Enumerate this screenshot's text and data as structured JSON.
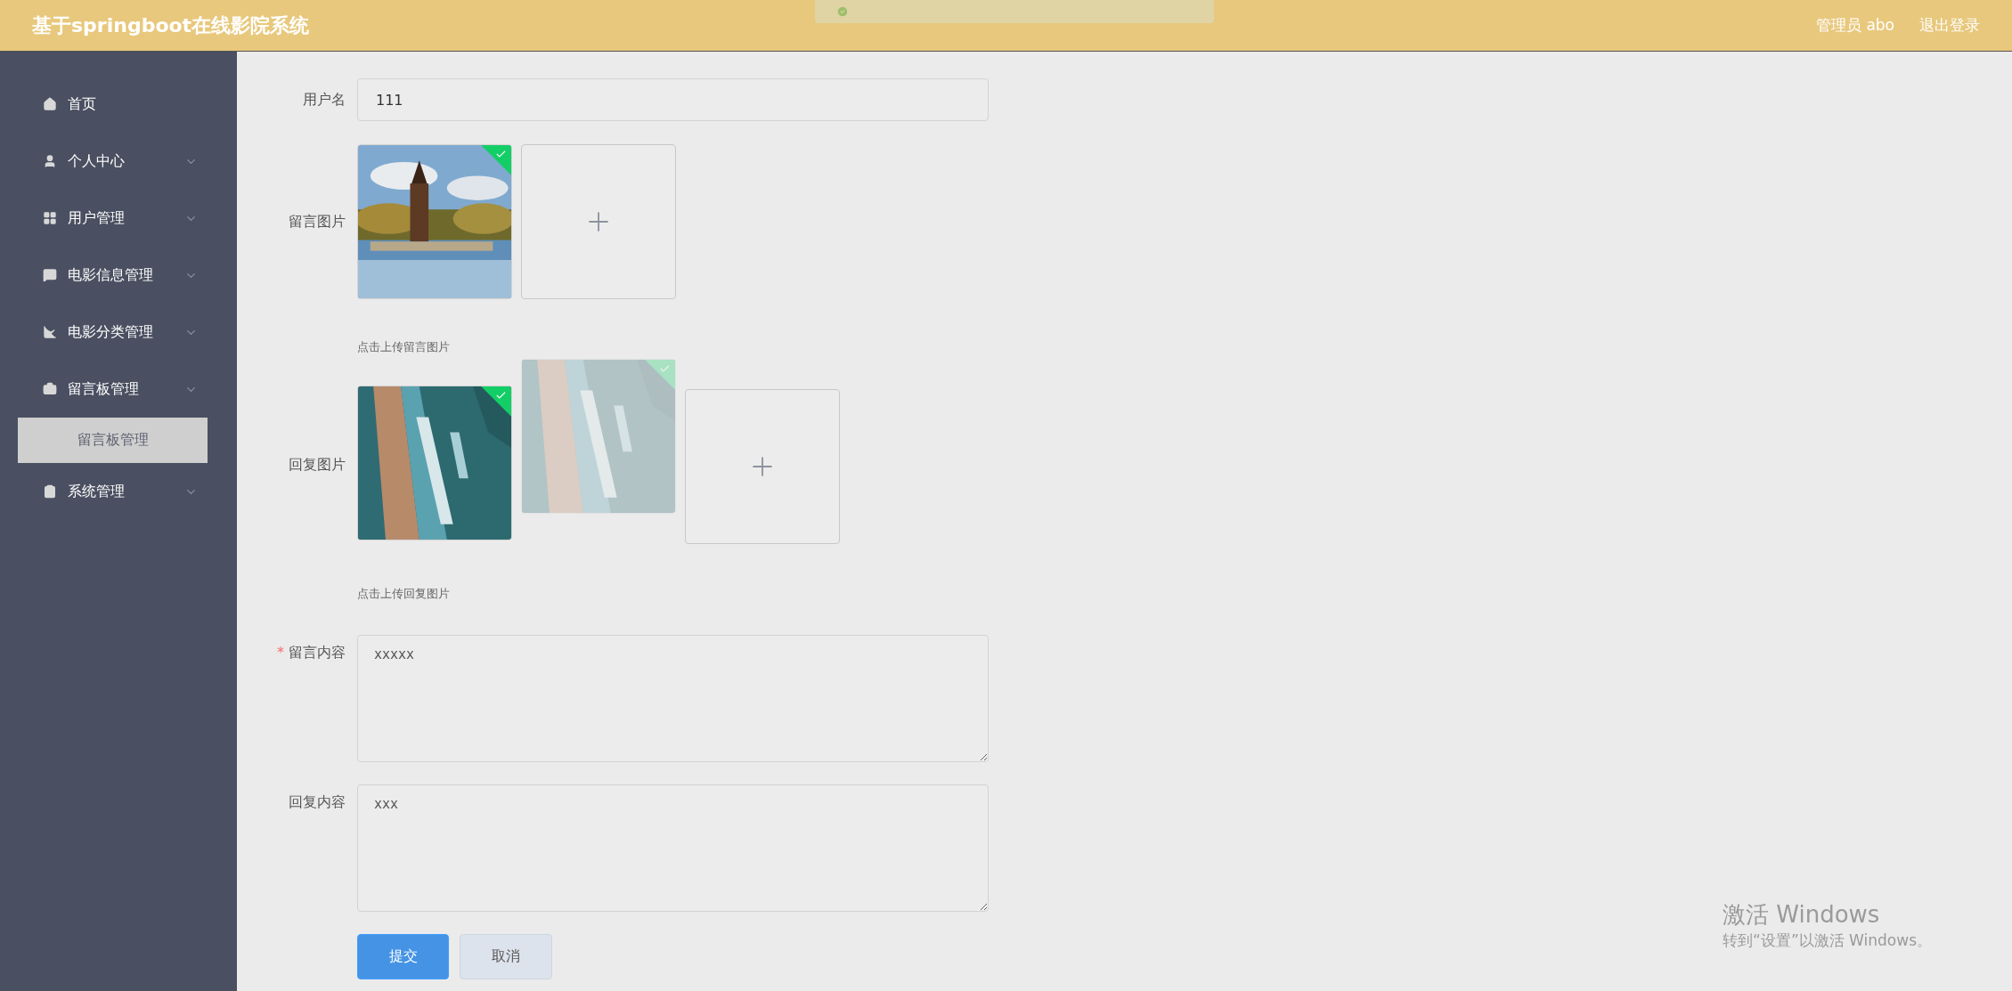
{
  "header": {
    "title": "基于springboot在线影院系统",
    "user": "管理员 abo",
    "logout": "退出登录"
  },
  "toast": {
    "kind": "success"
  },
  "sidebar": {
    "items": [
      {
        "label": "首页",
        "kind": "link"
      },
      {
        "label": "个人中心",
        "kind": "submenu"
      },
      {
        "label": "用户管理",
        "kind": "submenu"
      },
      {
        "label": "电影信息管理",
        "kind": "submenu"
      },
      {
        "label": "电影分类管理",
        "kind": "submenu"
      },
      {
        "label": "留言板管理",
        "kind": "submenu",
        "children": [
          {
            "label": "留言板管理",
            "selected": true
          }
        ]
      },
      {
        "label": "系统管理",
        "kind": "submenu"
      }
    ]
  },
  "form": {
    "username": {
      "label": "用户名",
      "value": "111"
    },
    "message_images": {
      "label": "留言图片",
      "hint": "点击上传留言图片",
      "images": [
        {
          "kind": "picture",
          "uploaded": true,
          "faded": false
        }
      ]
    },
    "reply_images": {
      "label": "回复图片",
      "hint": "点击上传回复图片",
      "images": [
        {
          "kind": "picture",
          "uploaded": true,
          "faded": false
        },
        {
          "kind": "picture",
          "uploaded": true,
          "faded": true
        }
      ]
    },
    "message_content": {
      "label": "留言内容",
      "value": "xxxxx",
      "required_mark": "*"
    },
    "reply_content": {
      "label": "回复内容",
      "value": "xxx"
    },
    "buttons": [
      {
        "label": "提交",
        "kind": "primary"
      },
      {
        "label": "取消",
        "kind": "default"
      }
    ]
  },
  "os_notice": {
    "title": "激活 Windows",
    "text": "转到“设置”以激活 Windows。"
  }
}
